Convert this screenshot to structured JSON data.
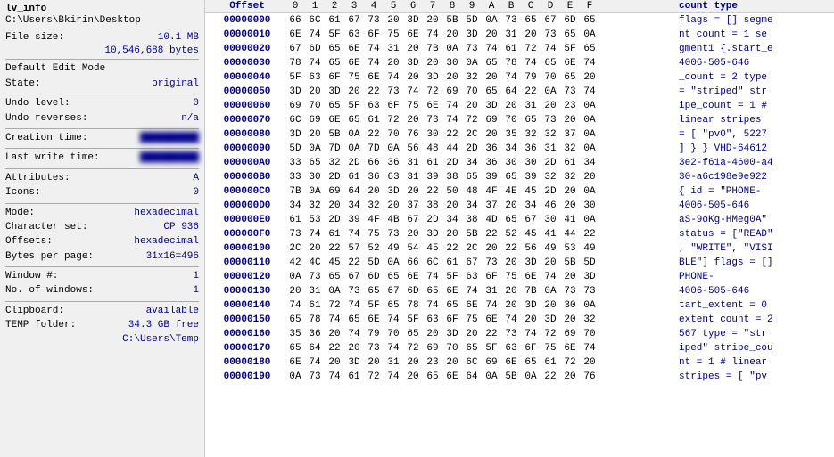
{
  "left": {
    "lv_info_label": "lv_info",
    "lv_path": "C:\\Users\\Bkirin\\Desktop",
    "file_size_label": "File size:",
    "file_size_mb": "10.1 MB",
    "file_size_bytes": "10,546,688 bytes",
    "edit_mode_label": "Default Edit Mode",
    "state_label": "State:",
    "state_value": "original",
    "undo_level_label": "Undo level:",
    "undo_level_value": "0",
    "undo_reverses_label": "Undo reverses:",
    "undo_reverses_value": "n/a",
    "creation_label": "Creation time:",
    "creation_value": "██████████",
    "last_write_label": "Last write time:",
    "last_write_value": "██████████",
    "attributes_label": "Attributes:",
    "attributes_value": "A",
    "icons_label": "Icons:",
    "icons_value": "0",
    "mode_label": "Mode:",
    "mode_value": "hexadecimal",
    "charset_label": "Character set:",
    "charset_value": "CP 936",
    "offsets_label": "Offsets:",
    "offsets_value": "hexadecimal",
    "bytes_per_page_label": "Bytes per page:",
    "bytes_per_page_value": "31x16=496",
    "window_label": "Window #:",
    "window_value": "1",
    "no_windows_label": "No. of windows:",
    "no_windows_value": "1",
    "clipboard_label": "Clipboard:",
    "clipboard_value": "available",
    "temp_label": "TEMP folder:",
    "temp_value": "34.3 GB free",
    "temp_path": "C:\\Users\\Temp"
  },
  "header": {
    "offset_label": "Offset",
    "cols": [
      "0",
      "1",
      "2",
      "3",
      "4",
      "5",
      "6",
      "7",
      "8",
      "9",
      "A",
      "B",
      "C",
      "D",
      "E",
      "F"
    ],
    "text_col": "count type"
  },
  "rows": [
    {
      "offset": "00000000",
      "bytes": [
        "66",
        "6C",
        "61",
        "67",
        "73",
        "20",
        "3D",
        "20",
        "5B",
        "5D",
        "0A",
        "73",
        "65",
        "67",
        "6D",
        "65"
      ],
      "text": "flags = [] segme"
    },
    {
      "offset": "00000010",
      "bytes": [
        "6E",
        "74",
        "5F",
        "63",
        "6F",
        "75",
        "6E",
        "74",
        "20",
        "3D",
        "20",
        "31",
        "20",
        "73",
        "65",
        "0A"
      ],
      "text": "nt_count = 1  se"
    },
    {
      "offset": "00000020",
      "bytes": [
        "67",
        "6D",
        "65",
        "6E",
        "74",
        "31",
        "20",
        "7B",
        "0A",
        "73",
        "74",
        "61",
        "72",
        "74",
        "5F",
        "65"
      ],
      "text": "gment1 {.start_e"
    },
    {
      "offset": "00000030",
      "bytes": [
        "78",
        "74",
        "65",
        "6E",
        "74",
        "20",
        "3D",
        "20",
        "30",
        "0A",
        "65",
        "78",
        "74",
        "65",
        "6E",
        "74"
      ],
      "text": "    4006-505-646"
    },
    {
      "offset": "00000040",
      "bytes": [
        "5F",
        "63",
        "6F",
        "75",
        "6E",
        "74",
        "20",
        "3D",
        "20",
        "32",
        "20",
        "74",
        "79",
        "70",
        "65",
        "20"
      ],
      "text": "_count = 2  type"
    },
    {
      "offset": "00000050",
      "bytes": [
        "3D",
        "20",
        "3D",
        "20",
        "22",
        "73",
        "74",
        "72",
        "69",
        "70",
        "65",
        "64",
        "22",
        "0A",
        "73",
        "74"
      ],
      "text": " = \"striped\" str"
    },
    {
      "offset": "00000060",
      "bytes": [
        "69",
        "70",
        "65",
        "5F",
        "63",
        "6F",
        "75",
        "6E",
        "74",
        "20",
        "3D",
        "20",
        "31",
        "20",
        "23",
        "0A"
      ],
      "text": "ipe_count = 1 #"
    },
    {
      "offset": "00000070",
      "bytes": [
        "6C",
        "69",
        "6E",
        "65",
        "61",
        "72",
        "20",
        "73",
        "74",
        "72",
        "69",
        "70",
        "65",
        "73",
        "20",
        "0A"
      ],
      "text": "linear  stripes"
    },
    {
      "offset": "00000080",
      "bytes": [
        "3D",
        "20",
        "5B",
        "0A",
        "22",
        "70",
        "76",
        "30",
        "22",
        "2C",
        "20",
        "35",
        "32",
        "32",
        "37",
        "0A"
      ],
      "text": "= [ \"pv0\", 5227"
    },
    {
      "offset": "00000090",
      "bytes": [
        "5D",
        "0A",
        "7D",
        "0A",
        "7D",
        "0A",
        "56",
        "48",
        "44",
        "2D",
        "36",
        "34",
        "36",
        "31",
        "32",
        "0A"
      ],
      "text": "] } }  VHD-64612"
    },
    {
      "offset": "000000A0",
      "bytes": [
        "33",
        "65",
        "32",
        "2D",
        "66",
        "36",
        "31",
        "61",
        "2D",
        "34",
        "36",
        "30",
        "30",
        "2D",
        "61",
        "34"
      ],
      "text": "3e2-f61a-4600-a4"
    },
    {
      "offset": "000000B0",
      "bytes": [
        "33",
        "30",
        "2D",
        "61",
        "36",
        "63",
        "31",
        "39",
        "38",
        "65",
        "39",
        "65",
        "39",
        "32",
        "32",
        "20"
      ],
      "text": "30-a6c198e9e922 "
    },
    {
      "offset": "000000C0",
      "bytes": [
        "7B",
        "0A",
        "69",
        "64",
        "20",
        "3D",
        "20",
        "22",
        "50",
        "48",
        "4F",
        "4E",
        "45",
        "2D",
        "20",
        "0A"
      ],
      "text": "{ id = \"PHONE-  "
    },
    {
      "offset": "000000D0",
      "bytes": [
        "34",
        "32",
        "20",
        "34",
        "32",
        "20",
        "37",
        "38",
        "20",
        "34",
        "37",
        "20",
        "34",
        "46",
        "20",
        "30"
      ],
      "text": "4006-505-646"
    },
    {
      "offset": "000000E0",
      "bytes": [
        "61",
        "53",
        "2D",
        "39",
        "4F",
        "4B",
        "67",
        "2D",
        "34",
        "38",
        "4D",
        "65",
        "67",
        "30",
        "41",
        "0A"
      ],
      "text": "aS-9oKg-HMeg0A\""
    },
    {
      "offset": "000000F0",
      "bytes": [
        "73",
        "74",
        "61",
        "74",
        "75",
        "73",
        "20",
        "3D",
        "20",
        "5B",
        "22",
        "52",
        "45",
        "41",
        "44",
        "22"
      ],
      "text": "status = [\"READ\""
    },
    {
      "offset": "00000100",
      "bytes": [
        "2C",
        "20",
        "22",
        "57",
        "52",
        "49",
        "54",
        "45",
        "22",
        "2C",
        "20",
        "22",
        "56",
        "49",
        "53",
        "49"
      ],
      "text": ", \"WRITE\", \"VISI"
    },
    {
      "offset": "00000110",
      "bytes": [
        "42",
        "4C",
        "45",
        "22",
        "5D",
        "0A",
        "66",
        "6C",
        "61",
        "67",
        "73",
        "20",
        "3D",
        "20",
        "5B",
        "5D"
      ],
      "text": "BLE\"] flags = []"
    },
    {
      "offset": "00000120",
      "bytes": [
        "0A",
        "73",
        "65",
        "67",
        "6D",
        "65",
        "6E",
        "74",
        "5F",
        "63",
        "6F",
        "75",
        "6E",
        "74",
        "20",
        "3D"
      ],
      "text": "      PHONE-"
    },
    {
      "offset": "00000130",
      "bytes": [
        "20",
        "31",
        "0A",
        "73",
        "65",
        "67",
        "6D",
        "65",
        "6E",
        "74",
        "31",
        "20",
        "7B",
        "0A",
        "73",
        "73"
      ],
      "text": "    4006-505-646"
    },
    {
      "offset": "00000140",
      "bytes": [
        "74",
        "61",
        "72",
        "74",
        "5F",
        "65",
        "78",
        "74",
        "65",
        "6E",
        "74",
        "20",
        "3D",
        "20",
        "30",
        "0A"
      ],
      "text": "tart_extent = 0"
    },
    {
      "offset": "00000150",
      "bytes": [
        "65",
        "78",
        "74",
        "65",
        "6E",
        "74",
        "5F",
        "63",
        "6F",
        "75",
        "6E",
        "74",
        "20",
        "3D",
        "20",
        "32"
      ],
      "text": "extent_count = 2"
    },
    {
      "offset": "00000160",
      "bytes": [
        "35",
        "36",
        "20",
        "74",
        "79",
        "70",
        "65",
        "20",
        "3D",
        "20",
        "22",
        "73",
        "74",
        "72",
        "69",
        "70"
      ],
      "text": "567  type = \"str"
    },
    {
      "offset": "00000170",
      "bytes": [
        "65",
        "64",
        "22",
        "20",
        "73",
        "74",
        "72",
        "69",
        "70",
        "65",
        "5F",
        "63",
        "6F",
        "75",
        "6E",
        "74"
      ],
      "text": "iped\" stripe_cou"
    },
    {
      "offset": "00000180",
      "bytes": [
        "6E",
        "74",
        "20",
        "3D",
        "20",
        "31",
        "20",
        "23",
        "20",
        "6C",
        "69",
        "6E",
        "65",
        "61",
        "72",
        "20"
      ],
      "text": "nt = 1 # linear "
    },
    {
      "offset": "00000190",
      "bytes": [
        "0A",
        "73",
        "74",
        "61",
        "72",
        "74",
        "20",
        "65",
        "6E",
        "64",
        "0A",
        "5B",
        "0A",
        "22",
        "20",
        "76"
      ],
      "text": "stripes = [ \"pv"
    }
  ]
}
